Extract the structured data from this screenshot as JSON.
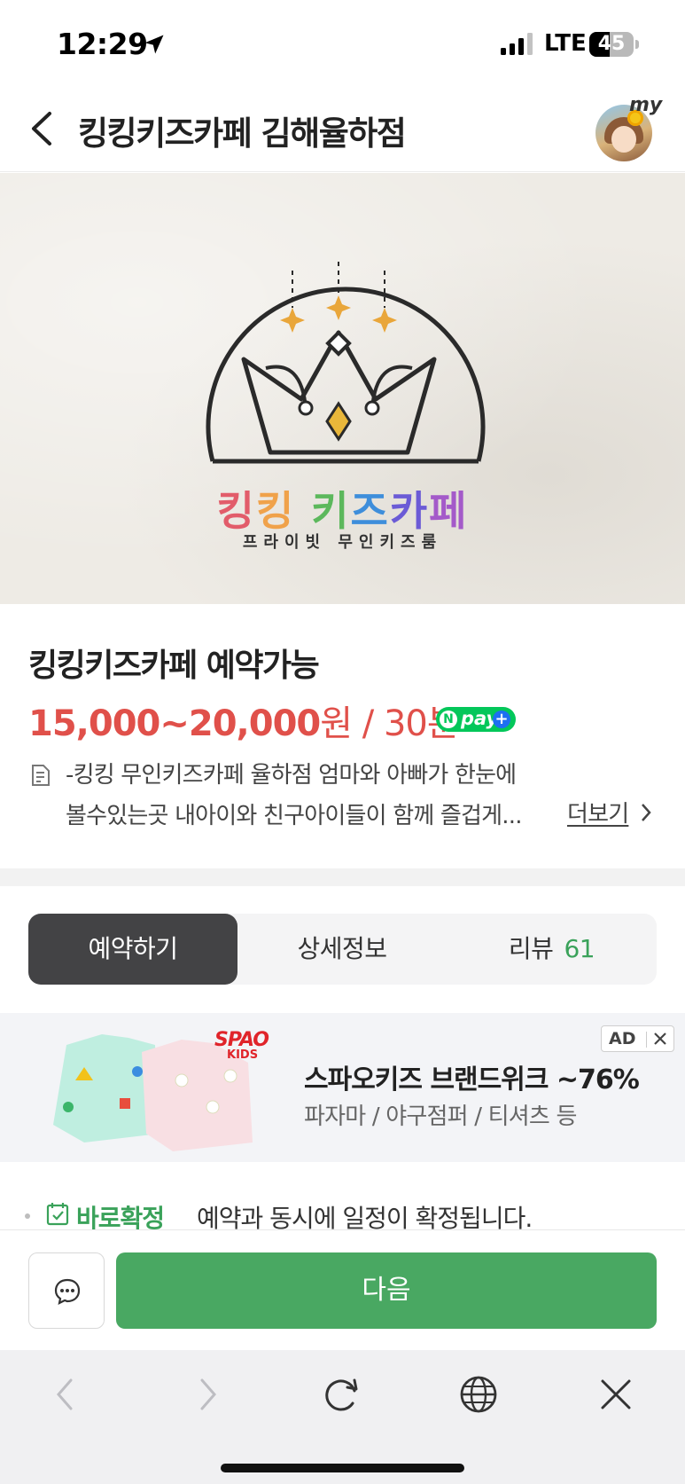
{
  "status_bar": {
    "time": "12:29",
    "network": "LTE",
    "battery": "45",
    "battery_level": 0.45
  },
  "header": {
    "title": "킹킹키즈카페 김해율하점",
    "avatar_label": "my"
  },
  "hero": {
    "brand_name": [
      "킹",
      "킹",
      " ",
      "키",
      "즈",
      "카",
      "페"
    ],
    "brand_colors": [
      "#e25c6a",
      "#f0a24a",
      "#ffffff",
      "#5cb85c",
      "#3e8edb",
      "#6b5bd6",
      "#a45ac9"
    ],
    "brand_subtitle": "프라이빗 무인키즈룸"
  },
  "product": {
    "title": "킹킹키즈카페 예약가능",
    "price_range": "15,000~20,000",
    "price_unit": "원 / 30분",
    "npay_label": "pay",
    "description_line1": "-킹킹 무인키즈카페 율하점 엄마와 아빠가 한눈에",
    "description_line2": "볼수있는곳 내아이와 친구아이들이 함께 즐겁게...",
    "more_label": "더보기"
  },
  "tabs": [
    {
      "label": "예약하기",
      "active": true
    },
    {
      "label": "상세정보",
      "active": false
    },
    {
      "label": "리뷰",
      "count": "61",
      "active": false
    }
  ],
  "ad": {
    "brand": "SPAO",
    "brand_sub": "KIDS",
    "title": "스파오키즈 브랜드위크 ~76%",
    "subtitle": "파자마 / 야구점퍼 / 티셔츠 등",
    "badge": "AD"
  },
  "confirm": {
    "strong": "바로확정",
    "text": "예약과 동시에 일정이 확정됩니다."
  },
  "actions": {
    "next_label": "다음"
  },
  "colors": {
    "accent_green": "#49a862",
    "price_red": "#e0504a",
    "tab_active": "#434345"
  }
}
